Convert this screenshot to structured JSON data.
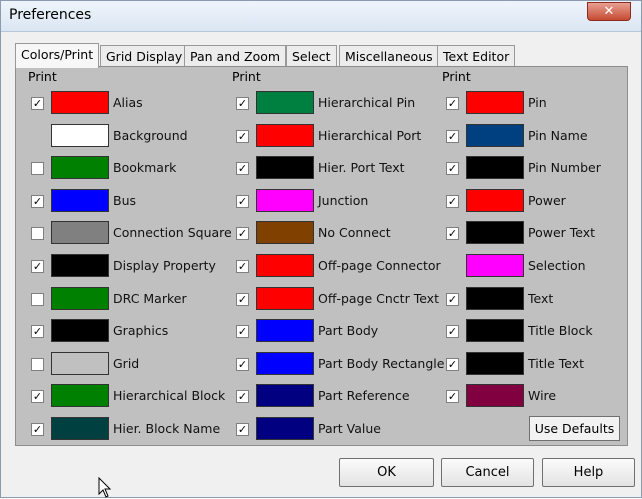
{
  "window": {
    "title": "Preferences",
    "close_glyph": "✕"
  },
  "tabs": [
    "Colors/Print",
    "Grid Display",
    "Pan and Zoom",
    "Select",
    "Miscellaneous",
    "Text Editor"
  ],
  "print_header": "Print",
  "columns": [
    [
      {
        "label": "Alias",
        "checked": true,
        "color": "#ff0000"
      },
      {
        "label": "Background",
        "checked": null,
        "color": "#ffffff"
      },
      {
        "label": "Bookmark",
        "checked": false,
        "color": "#008000"
      },
      {
        "label": "Bus",
        "checked": true,
        "color": "#0000ff"
      },
      {
        "label": "Connection Square",
        "checked": false,
        "color": "#808080"
      },
      {
        "label": "Display Property",
        "checked": true,
        "color": "#000000"
      },
      {
        "label": "DRC Marker",
        "checked": false,
        "color": "#008000"
      },
      {
        "label": "Graphics",
        "checked": true,
        "color": "#000000"
      },
      {
        "label": "Grid",
        "checked": false,
        "color": "#c0c0c0"
      },
      {
        "label": "Hierarchical Block",
        "checked": true,
        "color": "#008000"
      },
      {
        "label": "Hier. Block Name",
        "checked": true,
        "color": "#004040"
      }
    ],
    [
      {
        "label": "Hierarchical Pin",
        "checked": true,
        "color": "#008040"
      },
      {
        "label": "Hierarchical Port",
        "checked": true,
        "color": "#ff0000"
      },
      {
        "label": "Hier. Port Text",
        "checked": true,
        "color": "#000000"
      },
      {
        "label": "Junction",
        "checked": true,
        "color": "#ff00ff"
      },
      {
        "label": "No Connect",
        "checked": true,
        "color": "#804000"
      },
      {
        "label": "Off-page Connector",
        "checked": true,
        "color": "#ff0000"
      },
      {
        "label": "Off-page Cnctr Text",
        "checked": true,
        "color": "#ff0000"
      },
      {
        "label": "Part Body",
        "checked": true,
        "color": "#0000ff"
      },
      {
        "label": "Part Body Rectangle",
        "checked": true,
        "color": "#0000ff"
      },
      {
        "label": "Part Reference",
        "checked": true,
        "color": "#000080"
      },
      {
        "label": "Part Value",
        "checked": true,
        "color": "#000080"
      }
    ],
    [
      {
        "label": "Pin",
        "checked": true,
        "color": "#ff0000"
      },
      {
        "label": "Pin Name",
        "checked": true,
        "color": "#004080"
      },
      {
        "label": "Pin Number",
        "checked": true,
        "color": "#000000"
      },
      {
        "label": "Power",
        "checked": true,
        "color": "#ff0000"
      },
      {
        "label": "Power Text",
        "checked": true,
        "color": "#000000"
      },
      {
        "label": "Selection",
        "checked": null,
        "color": "#ff00ff"
      },
      {
        "label": "Text",
        "checked": true,
        "color": "#000000"
      },
      {
        "label": "Title Block",
        "checked": true,
        "color": "#000000"
      },
      {
        "label": "Title Text",
        "checked": true,
        "color": "#000000"
      },
      {
        "label": "Wire",
        "checked": true,
        "color": "#800040"
      }
    ]
  ],
  "buttons": {
    "use_defaults": "Use Defaults",
    "ok": "OK",
    "cancel": "Cancel",
    "help": "Help"
  }
}
